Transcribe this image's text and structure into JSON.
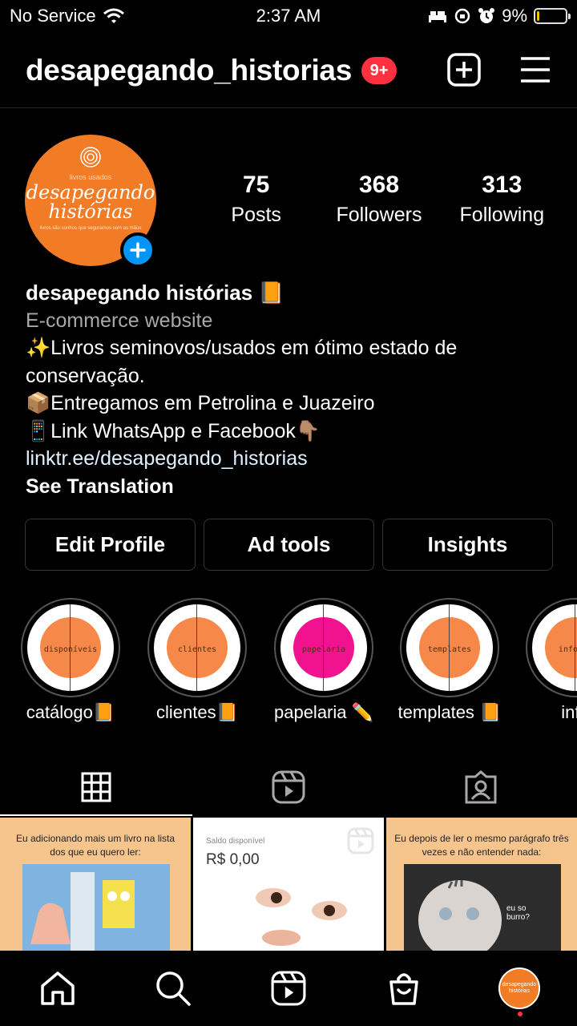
{
  "status_bar": {
    "carrier": "No Service",
    "time": "2:37 AM",
    "battery": "9%",
    "battery_level": 0.09
  },
  "header": {
    "username": "desapegando_historias",
    "notification_badge": "9+"
  },
  "profile": {
    "avatar_small_text": "livros usados",
    "avatar_brand": "desapegando histórias",
    "avatar_tagline": "livros são sonhos que seguramos com as mãos",
    "stats": [
      {
        "value": "75",
        "label": "Posts"
      },
      {
        "value": "368",
        "label": "Followers"
      },
      {
        "value": "313",
        "label": "Following"
      }
    ],
    "name": "desapegando histórias 📙",
    "category": "E-commerce website",
    "bio_lines": [
      "✨Livros seminovos/usados em ótimo estado de conservação.",
      "📦Entregamos em Petrolina e Juazeiro",
      "📱Link WhatsApp e Facebook👇🏽"
    ],
    "link": "linktr.ee/desapegando_historias",
    "see_translation": "See Translation"
  },
  "buttons": {
    "edit_profile": "Edit Profile",
    "ad_tools": "Ad tools",
    "insights": "Insights"
  },
  "highlights": [
    {
      "cover_text": "disponíveis",
      "caption": "catálogo📙",
      "color": "#f6894a"
    },
    {
      "cover_text": "clientes",
      "caption": "clientes📙",
      "color": "#f6894a"
    },
    {
      "cover_text": "papelaria",
      "caption": "papelaria ✏️",
      "color": "#f0128f"
    },
    {
      "cover_text": "templates",
      "caption": "templates 📙",
      "color": "#f6894a"
    },
    {
      "cover_text": "informa",
      "caption": "info",
      "color": "#f6894a"
    }
  ],
  "posts": {
    "post1_text": "Eu adicionando mais um livro na lista dos que eu quero ler:",
    "post2_label": "Saldo disponível",
    "post2_amount": "R$ 0,00",
    "post3_text": "Eu depois de ler o mesmo parágrafo três vezes e não entender nada:",
    "post3_overlay": "eu so burro?"
  },
  "bottom_nav": {
    "avatar_text": "desapegando histórias"
  },
  "colors": {
    "accent_blue": "#0095f6",
    "badge_red": "#ff3040",
    "brand_orange": "#f27c26",
    "link": "#e0f1ff"
  }
}
